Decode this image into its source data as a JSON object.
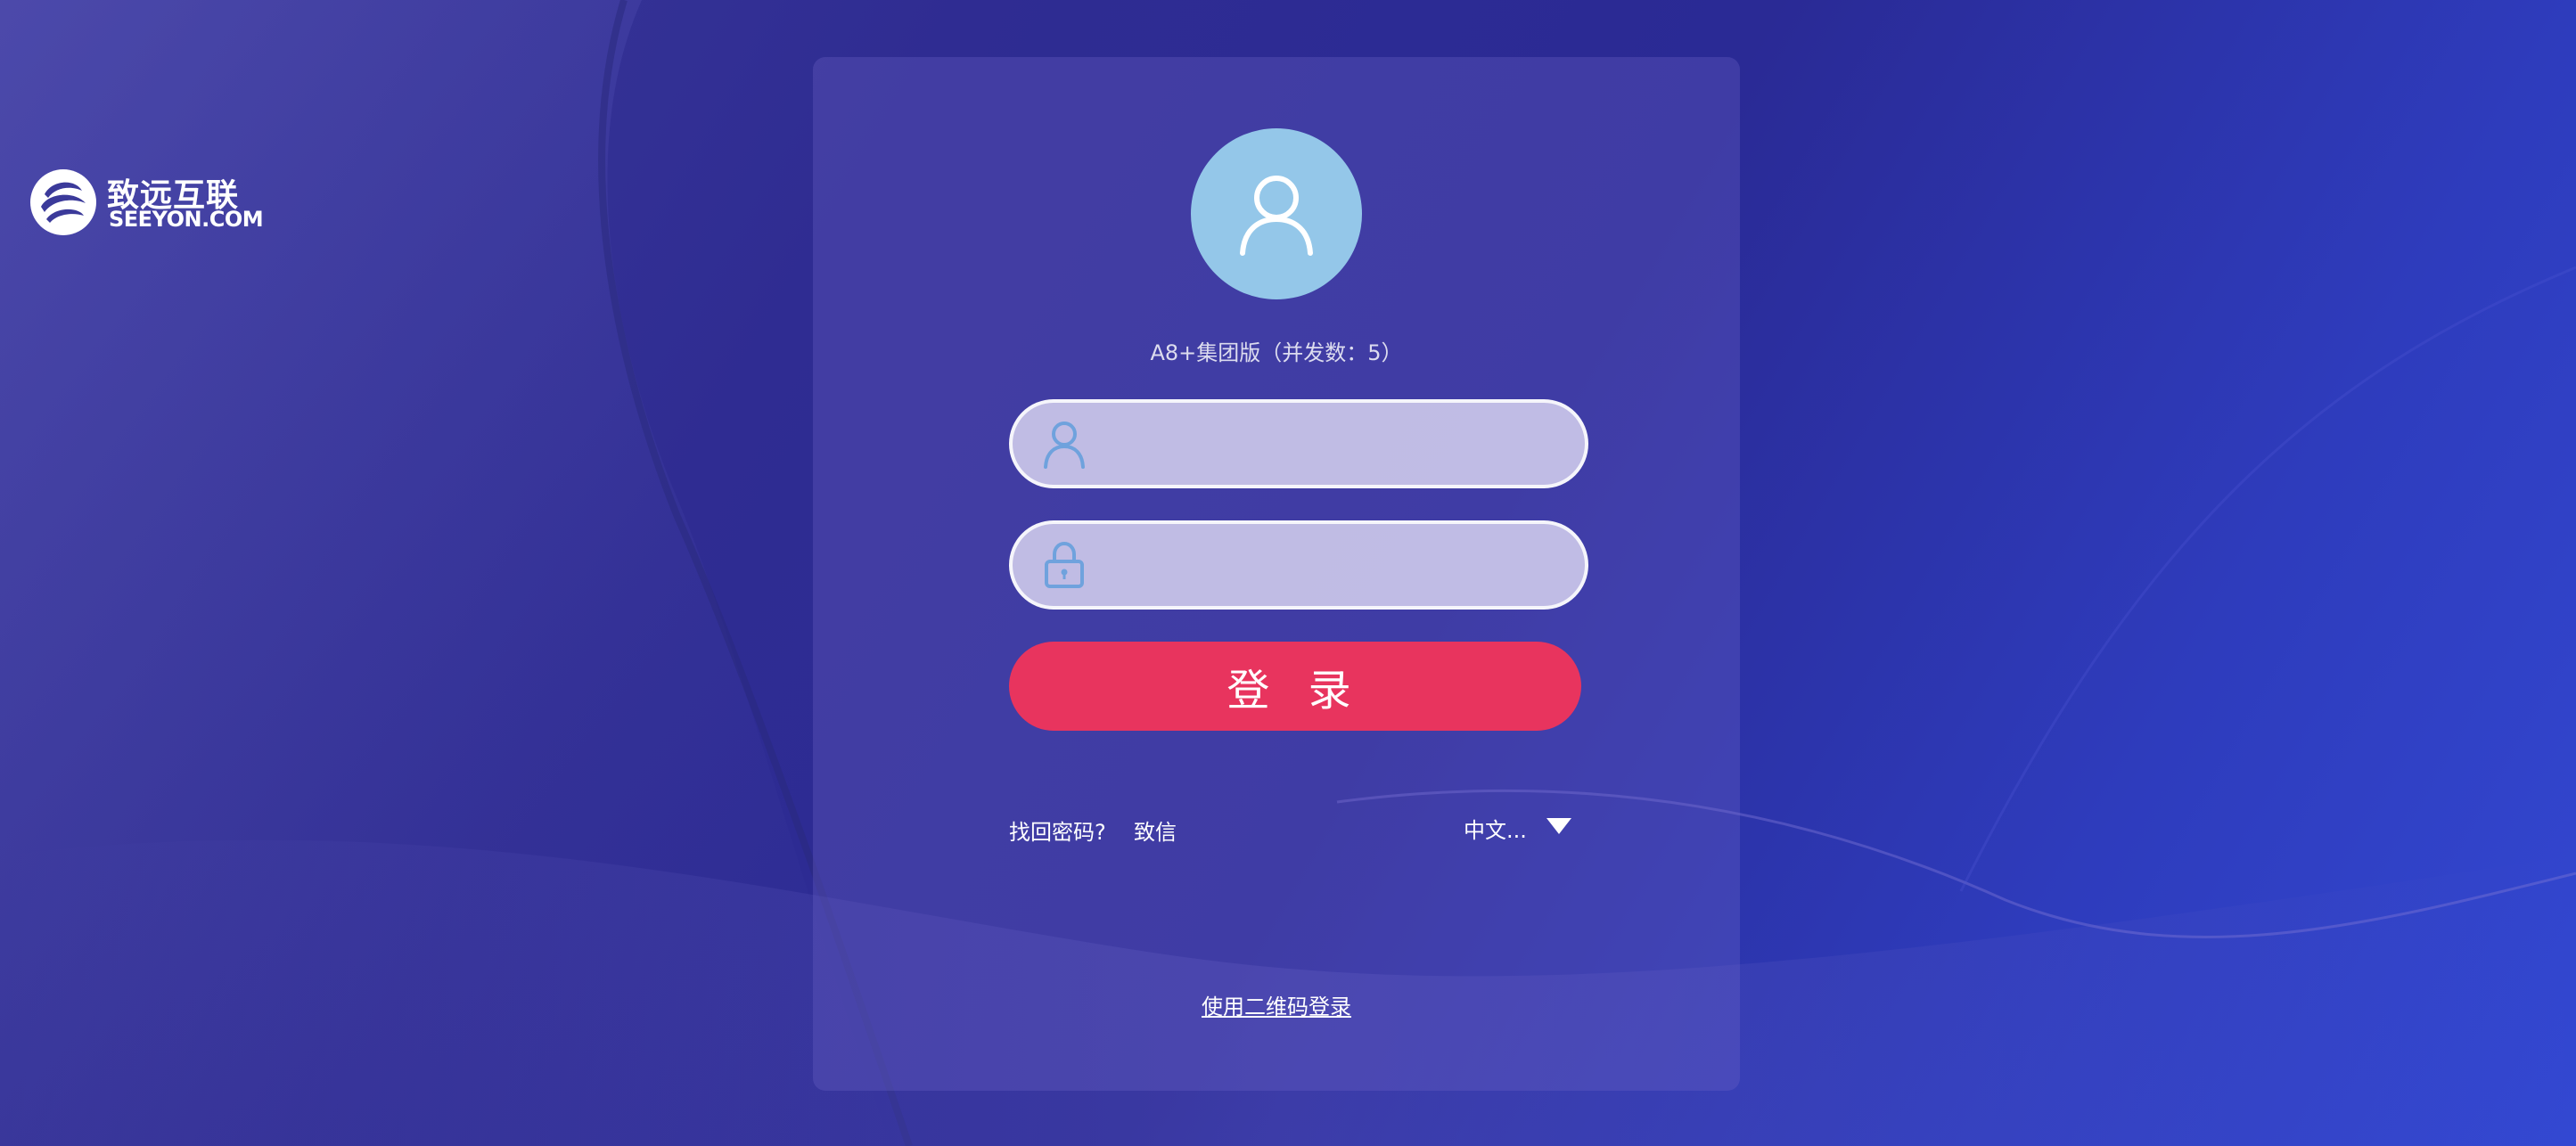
{
  "brand": {
    "name_cn": "致远互联",
    "name_en": "SEEYON.COM"
  },
  "login": {
    "product_label": "A8+集团版（并发数：5）",
    "username": {
      "value": "",
      "placeholder": ""
    },
    "password": {
      "value": "",
      "placeholder": ""
    },
    "submit_label": "登 录",
    "forgot_password_label": "找回密码?",
    "zhixin_label": "致信",
    "language": {
      "selected": "中文..."
    },
    "qr_login_label": "使用二维码登录"
  },
  "icons": {
    "avatar": "user-avatar-icon",
    "username": "user-icon",
    "password": "lock-icon",
    "language": "caret-down-icon"
  },
  "colors": {
    "accent": "#e8345e",
    "avatar_bg": "#94c7e9",
    "icon_blue": "#6fa2dd"
  }
}
